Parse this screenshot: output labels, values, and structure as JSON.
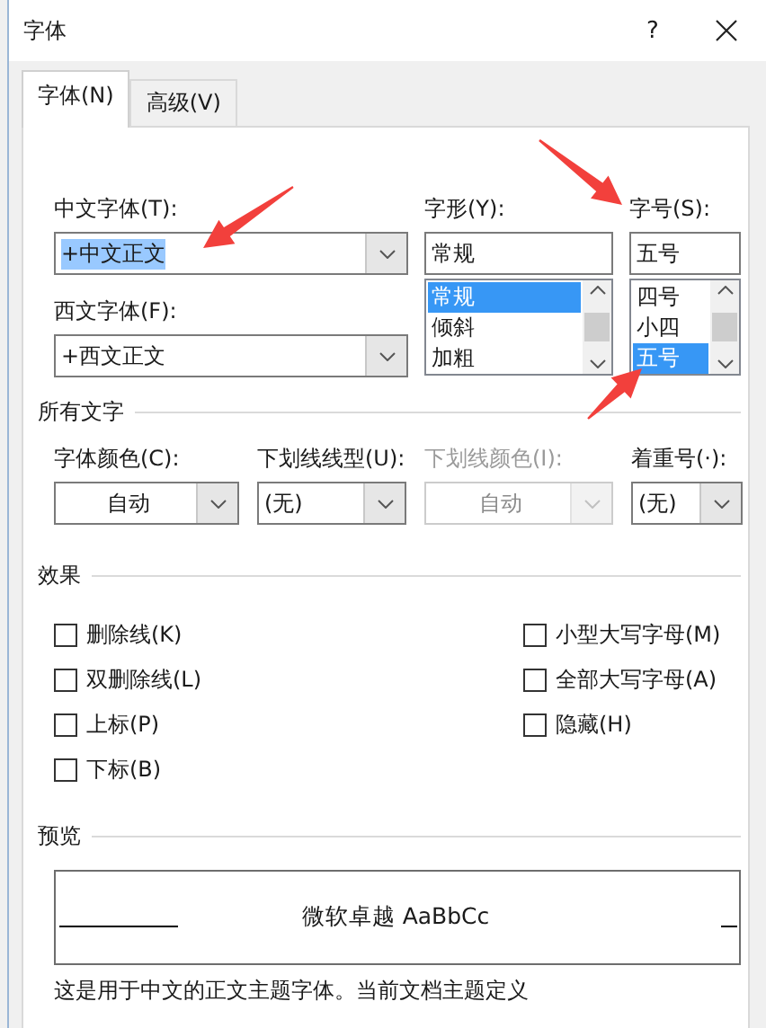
{
  "window": {
    "title": "字体",
    "help": "?"
  },
  "tabs": [
    {
      "label": "字体(N)",
      "selected": true
    },
    {
      "label": "高级(V)",
      "selected": false
    }
  ],
  "chinese_font": {
    "label": "中文字体(T):",
    "value": "+中文正文",
    "highlighted": true
  },
  "western_font": {
    "label": "西文字体(F):",
    "value": "+西文正文",
    "highlighted": false
  },
  "style": {
    "label": "字形(Y):",
    "value": "常规",
    "options": [
      {
        "label": "常规",
        "selected": true
      },
      {
        "label": "倾斜",
        "selected": false
      },
      {
        "label": "加粗",
        "selected": false
      }
    ]
  },
  "size": {
    "label": "字号(S):",
    "value": "五号",
    "options": [
      {
        "label": "四号",
        "selected": false
      },
      {
        "label": "小四",
        "selected": false
      },
      {
        "label": "五号",
        "selected": true
      }
    ]
  },
  "all_text": {
    "heading": "所有文字",
    "dropdowns": [
      {
        "label": "字体颜色(C):",
        "value": "自动",
        "centered": true,
        "disabled": false
      },
      {
        "label": "下划线线型(U):",
        "value": "(无)",
        "centered": false,
        "disabled": false
      },
      {
        "label": "下划线颜色(I):",
        "value": "自动",
        "centered": true,
        "disabled": true
      },
      {
        "label": "着重号(·):",
        "value": "(无)",
        "centered": false,
        "disabled": false
      }
    ]
  },
  "effects": {
    "heading": "效果",
    "left": [
      {
        "label": "删除线(K)",
        "checked": false
      },
      {
        "label": "双删除线(L)",
        "checked": false
      },
      {
        "label": "上标(P)",
        "checked": false
      },
      {
        "label": "下标(B)",
        "checked": false
      }
    ],
    "right": [
      {
        "label": "小型大写字母(M)",
        "checked": false
      },
      {
        "label": "全部大写字母(A)",
        "checked": false
      },
      {
        "label": "隐藏(H)",
        "checked": false
      }
    ]
  },
  "preview": {
    "heading": "预览",
    "sample": "微软卓越  AaBbCc",
    "note": "这是用于中文的正文主题字体。当前文档主题定义"
  }
}
